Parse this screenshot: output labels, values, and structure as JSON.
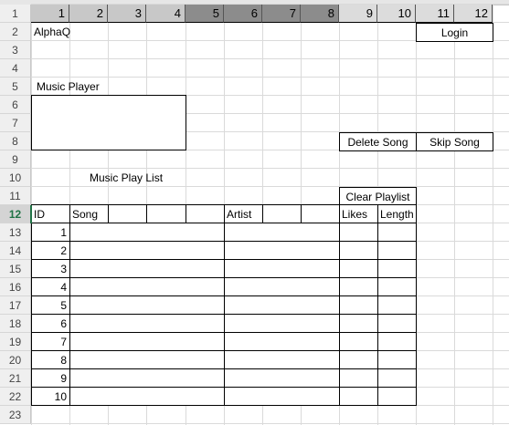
{
  "column_numbers": [
    "1",
    "2",
    "3",
    "4",
    "5",
    "6",
    "7",
    "8",
    "9",
    "10",
    "11",
    "12"
  ],
  "row_numbers": [
    "1",
    "2",
    "3",
    "4",
    "5",
    "6",
    "7",
    "8",
    "9",
    "10",
    "11",
    "12",
    "13",
    "14",
    "15",
    "16",
    "17",
    "18",
    "19",
    "20",
    "21",
    "22",
    "23"
  ],
  "active_row": "12",
  "header_colors": {
    "group1": "#c8c8c8",
    "group2": "#8c8c8c",
    "group3": "#dcdcdc"
  },
  "app_title": "AlphaQ",
  "buttons": {
    "login": "Login",
    "delete_song": "Delete Song",
    "skip_song": "Skip Song",
    "clear_playlist": "Clear Playlist"
  },
  "player": {
    "label": "Music Player"
  },
  "playlist": {
    "title": "Music Play List",
    "headers": {
      "id": "ID",
      "song": "Song",
      "artist": "Artist",
      "likes": "Likes",
      "length": "Length"
    },
    "ids": [
      "1",
      "2",
      "3",
      "4",
      "5",
      "6",
      "7",
      "8",
      "9",
      "10"
    ]
  }
}
